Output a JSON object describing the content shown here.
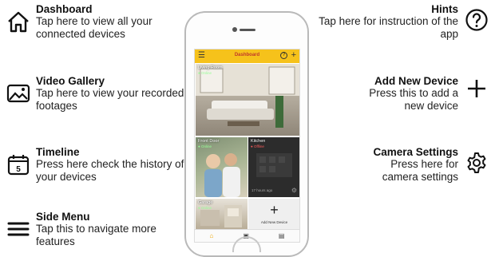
{
  "dashboard": {
    "title": "Dashboard",
    "text": "Tap here to view all your connected devices"
  },
  "video_gallery": {
    "title": "Video Gallery",
    "text": "Tap here to view your recorded footages"
  },
  "timeline": {
    "title": "Timeline",
    "text": "Press here check the history of your devices",
    "icon_number": "5"
  },
  "side_menu": {
    "title": "Side Menu",
    "text": "Tap this to navigate more features"
  },
  "hints": {
    "title": "Hints",
    "text": "Tap here for instruction of the app"
  },
  "add_new_device": {
    "title": "Add New Device",
    "text": "Press this to add a new device"
  },
  "camera_settings": {
    "title": "Camera Settings",
    "text": "Press here for camera settings"
  },
  "app": {
    "header_title": "Dashboard",
    "help_glyph": "?",
    "tiles": {
      "living": {
        "label": "Living Room",
        "status": "● Online"
      },
      "front": {
        "label": "Front Door",
        "status": "● Online"
      },
      "kitchen": {
        "label": "Kitchen",
        "status": "● Offline",
        "time": "17 hours ago"
      },
      "cam4": {
        "label": "Garage",
        "status": "● Online"
      },
      "add": {
        "label": "Add New Device"
      }
    }
  },
  "colors": {
    "accent": "#f6c21b",
    "brand_text": "#c0392b",
    "tab_active": "#f0a500"
  }
}
